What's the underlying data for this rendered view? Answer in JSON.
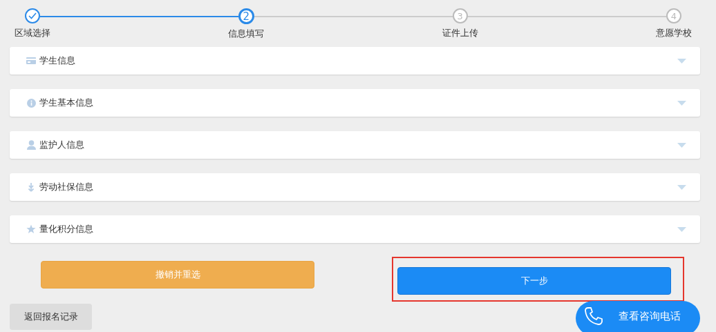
{
  "steps": [
    {
      "label": "区域选择",
      "done": true,
      "selected": false
    },
    {
      "number": "2",
      "label": "信息填写",
      "done": false,
      "selected": true
    },
    {
      "number": "3",
      "label": "证件上传",
      "done": false,
      "selected": false
    },
    {
      "number": "4",
      "label": "意愿学校",
      "done": false,
      "selected": false
    }
  ],
  "sections": [
    {
      "kind": "card",
      "title": "学生信息",
      "expanded": false
    },
    {
      "kind": "info",
      "title": "学生基本信息",
      "expanded": false
    },
    {
      "kind": "person",
      "title": "监护人信息",
      "expanded": false
    },
    {
      "kind": "plant",
      "title": "劳动社保信息",
      "expanded": false
    },
    {
      "kind": "star",
      "title": "量化积分信息",
      "expanded": false
    }
  ],
  "actions": {
    "reset": "撤销并重选",
    "next": "下一步",
    "next_highlighted": true
  },
  "back_button": "返回报名记录",
  "contact_button": "查看咨询电话"
}
